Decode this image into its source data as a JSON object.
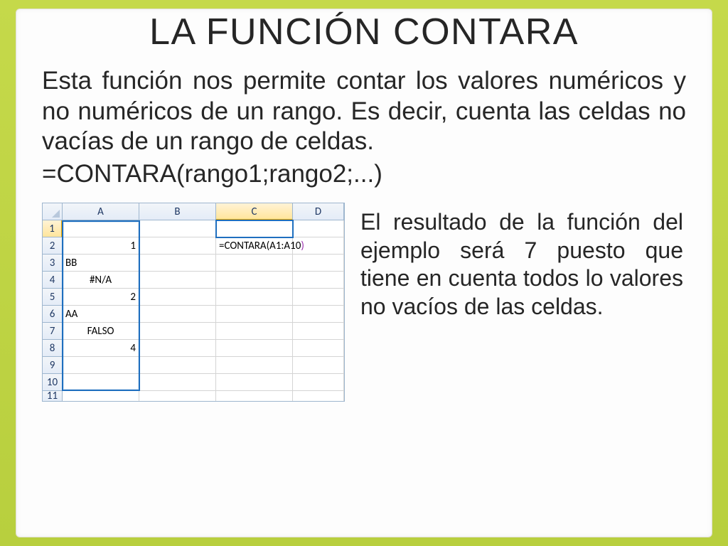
{
  "title": "LA FUNCIÓN CONTARA",
  "description": "Esta función nos permite contar los valores numéricos y no numéricos de un rango. Es decir, cuenta las celdas no vacías de un rango de celdas.",
  "syntax": "=CONTARA(rango1;rango2;...)",
  "side_text": "El resultado de la función del ejemplo será 7 puesto que tiene en cuenta todos lo valores no vacíos de las celdas.",
  "spreadsheet": {
    "columns": [
      "A",
      "B",
      "C",
      "D"
    ],
    "rows": [
      "1",
      "2",
      "3",
      "4",
      "5",
      "6",
      "7",
      "8",
      "9",
      "10",
      "11"
    ],
    "formula_display": "=CONTARA(A1:A10)",
    "formula_prefix": "=CONTARA(A1:A10",
    "formula_paren": ")",
    "cells": {
      "A2": "1",
      "A3": "BB",
      "A4": "#N/A",
      "A5": "2",
      "A6": "AA",
      "A7": "FALSO",
      "A8": "4"
    }
  }
}
